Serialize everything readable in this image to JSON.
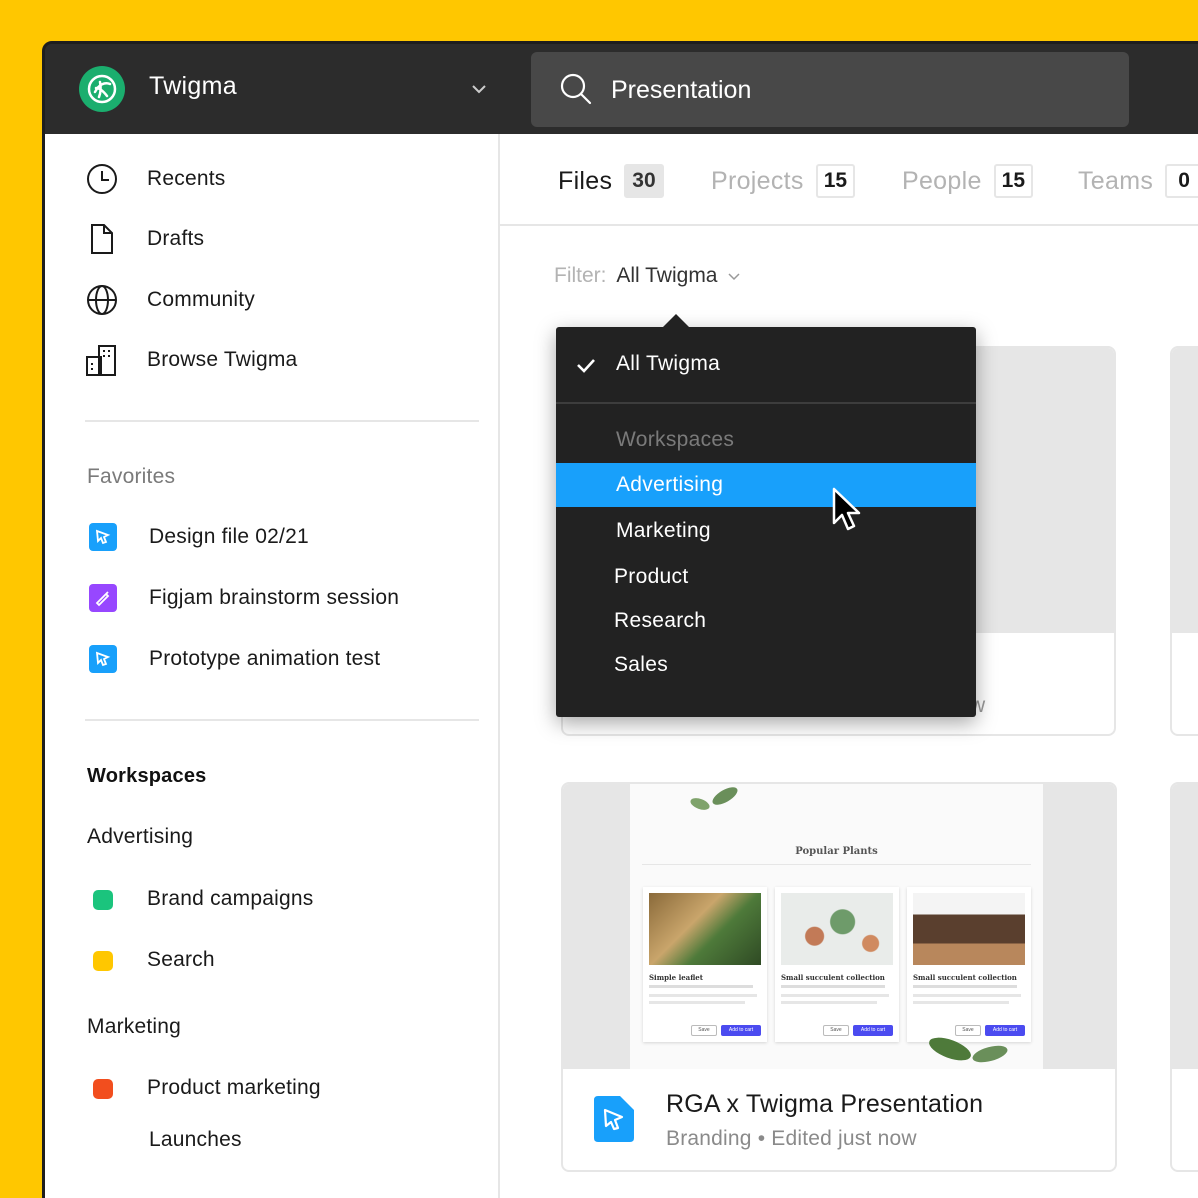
{
  "app": {
    "name": "Twigma"
  },
  "search": {
    "value": "Presentation"
  },
  "sidebar": {
    "nav": [
      {
        "label": "Recents",
        "icon": "clock-icon"
      },
      {
        "label": "Drafts",
        "icon": "file-icon"
      },
      {
        "label": "Community",
        "icon": "globe-icon"
      },
      {
        "label": "Browse Twigma",
        "icon": "building-icon"
      }
    ],
    "favorites_title": "Favorites",
    "favorites": [
      {
        "label": "Design file 02/21",
        "icon": "design-file-icon",
        "color": "#18A0FB"
      },
      {
        "label": "Figjam brainstorm session",
        "icon": "figjam-icon",
        "color": "#9747FF"
      },
      {
        "label": "Prototype animation test",
        "icon": "design-file-icon",
        "color": "#18A0FB"
      }
    ],
    "workspaces_title": "Workspaces",
    "groups": [
      {
        "label": "Advertising",
        "teams": [
          {
            "label": "Brand campaigns",
            "color": "#1BC47D"
          },
          {
            "label": "Search",
            "color": "#FFC700"
          }
        ]
      },
      {
        "label": "Marketing",
        "teams": [
          {
            "label": "Product marketing",
            "color": "#F24E1E"
          },
          {
            "label": "Launches",
            "color": ""
          }
        ]
      }
    ]
  },
  "tabs": [
    {
      "label": "Files",
      "count": "30",
      "active": true
    },
    {
      "label": "Projects",
      "count": "15"
    },
    {
      "label": "People",
      "count": "15"
    },
    {
      "label": "Teams",
      "count": "0"
    }
  ],
  "filter": {
    "label": "Filter:",
    "value": "All Twigma"
  },
  "dropdown": {
    "checked": "All Twigma",
    "header": "Workspaces",
    "items": [
      "Advertising",
      "Marketing",
      "Product",
      "Research",
      "Sales"
    ],
    "selected": "Advertising"
  },
  "card": {
    "title": "RGA x Twigma Presentation",
    "subtitle": "Branding • Edited just now",
    "preview": {
      "heading": "Popular Plants",
      "products": [
        {
          "name": "Simple leaflet",
          "save": "Save",
          "cart": "Add to cart"
        },
        {
          "name": "Small succulent collection",
          "save": "Save",
          "cart": "Add to cart"
        },
        {
          "name": "Small succulent collection",
          "save": "Save",
          "cart": "Add to cart"
        }
      ]
    }
  },
  "peek": {
    "text": "w"
  },
  "colors": {
    "accent": "#18A0FB",
    "topbar": "#2C2C2C",
    "background": "#FFC700"
  }
}
